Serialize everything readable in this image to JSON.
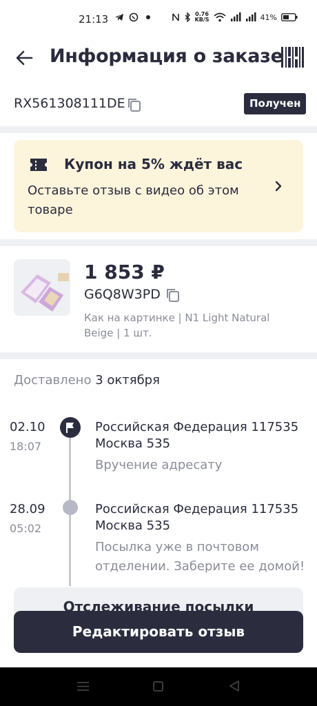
{
  "status_bar": {
    "time": "21:13",
    "net_speed_value": "0.76",
    "net_speed_unit": "KB/S",
    "battery": "41%"
  },
  "header": {
    "title": "Информация о заказе",
    "back_icon": "arrow-left-icon",
    "barcode_icon": "barcode-icon"
  },
  "order": {
    "tracking_number": "RX561308111DE",
    "status": "Получен"
  },
  "coupon": {
    "title": "Купон на 5% ждёт вас",
    "text": "Оставьте отзыв с видео об этом товаре"
  },
  "product": {
    "price": "1 853 ₽",
    "sku": "G6Q8W3PD",
    "variant": "Как на картинке | N1 Light Natural Beige | 1 шт."
  },
  "delivery": {
    "label": "Доставлено",
    "date": "3 октября"
  },
  "timeline": [
    {
      "date": "02.10",
      "time": "18:07",
      "place": "Российская Федерация 117535 Москва 535",
      "status": "Вручение адресату"
    },
    {
      "date": "28.09",
      "time": "05:02",
      "place": "Российская Федерация 117535 Москва 535",
      "status": "Посылка уже в почтовом отделении. Заберите ее домой!"
    }
  ],
  "buttons": {
    "track": "Отслеживание посылки",
    "review": "Редактировать отзыв"
  },
  "colors": {
    "primary_dark": "#2b2d3f",
    "coupon_bg": "#fdf4dc",
    "muted_text": "#8a8c98",
    "divider": "#eef0f3"
  }
}
